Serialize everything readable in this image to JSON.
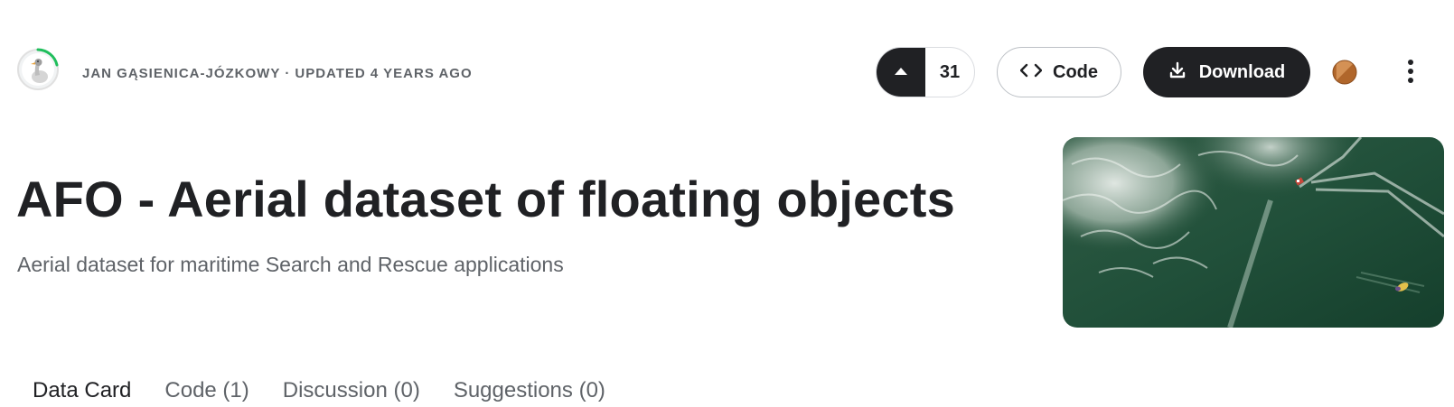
{
  "header": {
    "author": "Jan Gąsienica-Józkowy",
    "separator": "·",
    "updated": "Updated 4 years ago",
    "vote_count": "31",
    "code_button": "Code",
    "download_button": "Download"
  },
  "dataset": {
    "title": "AFO - Aerial dataset of floating objects",
    "subtitle": "Aerial dataset for maritime Search and Rescue applications"
  },
  "tabs": [
    {
      "label": "Data Card",
      "active": true
    },
    {
      "label": "Code (1)",
      "active": false
    },
    {
      "label": "Discussion (0)",
      "active": false
    },
    {
      "label": "Suggestions (0)",
      "active": false
    }
  ],
  "icons": {
    "vote": "caret-up-icon",
    "code": "code-brackets-icon",
    "download": "download-icon",
    "more": "more-vertical-icon",
    "author_avatar": "goose-avatar",
    "user_avatar": "user-avatar-icon"
  },
  "colors": {
    "dark": "#202124",
    "muted": "#5f6368",
    "progress_ring": "#20be5c",
    "sea": "#1f4d35"
  }
}
